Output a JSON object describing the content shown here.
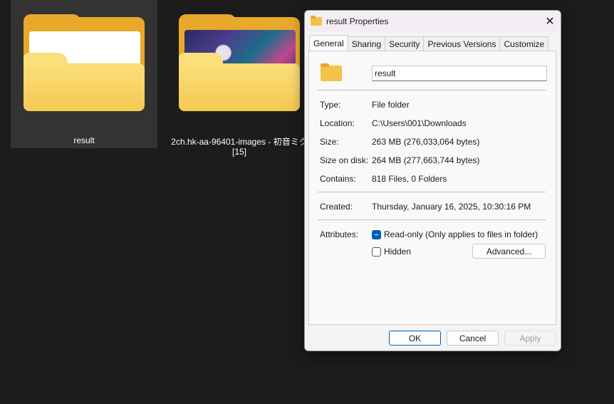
{
  "explorer": {
    "items": [
      {
        "name": "result"
      },
      {
        "name": "2ch.hk-aa-96401-images - 初音ミク [15]"
      }
    ]
  },
  "dialog": {
    "title": "result Properties",
    "close_glyph": "✕",
    "tabs": [
      "General",
      "Sharing",
      "Security",
      "Previous Versions",
      "Customize"
    ],
    "active_tab": "General",
    "folder_name": "result",
    "type_label": "Type:",
    "type_value": "File folder",
    "location_label": "Location:",
    "location_value": "C:\\Users\\001\\Downloads",
    "size_label": "Size:",
    "size_value": "263 MB (276,033,064 bytes)",
    "size_on_disk_label": "Size on disk:",
    "size_on_disk_value": "264 MB (277,663,744 bytes)",
    "contains_label": "Contains:",
    "contains_value": "818 Files, 0 Folders",
    "created_label": "Created:",
    "created_value": "Thursday, January 16, 2025, 10:30:16 PM",
    "attributes_label": "Attributes:",
    "readonly_label": "Read-only (Only applies to files in folder)",
    "hidden_label": "Hidden",
    "advanced_label": "Advanced...",
    "ok_label": "OK",
    "cancel_label": "Cancel",
    "apply_label": "Apply"
  },
  "colors": {
    "accent": "#005fb8",
    "folder": "#f4c24a",
    "background": "#1c1c1c"
  }
}
